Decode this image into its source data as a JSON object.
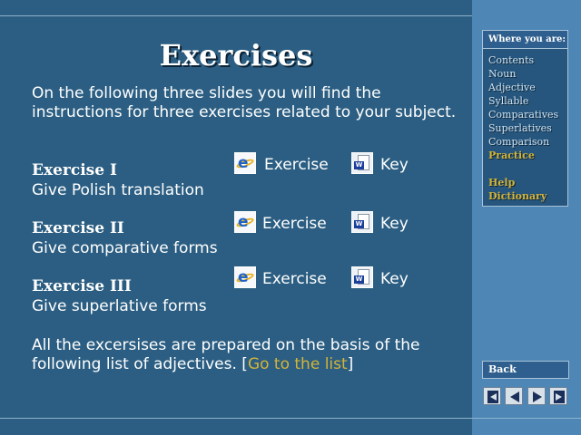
{
  "slide": {
    "title": "Exercises",
    "intro": "On the following three slides you will find the instructions for three exercises related to your subject.",
    "exercises": [
      {
        "heading": "Exercise I",
        "description": "Give Polish translation",
        "exercise_label": "Exercise",
        "key_label": "Key"
      },
      {
        "heading": "Exercise II",
        "description": "Give comparative forms",
        "exercise_label": "Exercise",
        "key_label": "Key"
      },
      {
        "heading": "Exercise III",
        "description": "Give superlative forms",
        "exercise_label": "Exercise",
        "key_label": "Key"
      }
    ],
    "outro_before": "All the excersises are prepared on the basis of the following list of adjectives. [",
    "outro_link": "Go to the list",
    "outro_after": "]"
  },
  "sidebar": {
    "panel_title": "Where you are:",
    "nav_items": [
      {
        "label": "Contents"
      },
      {
        "label": "Noun"
      },
      {
        "label": "Adjective"
      },
      {
        "label": "Syllable"
      },
      {
        "label": "Comparatives"
      },
      {
        "label": "Superlatives"
      },
      {
        "label": "Comparison"
      },
      {
        "label": "Practice"
      }
    ],
    "extra_items": [
      {
        "label": "Help"
      },
      {
        "label": "Dictionary"
      }
    ],
    "back_label": "Back",
    "nav_buttons": [
      "first-slide-icon",
      "previous-slide-icon",
      "next-slide-icon",
      "last-slide-icon"
    ]
  },
  "colors": {
    "background": "#2b5e82",
    "sidebar": "#4e86b5",
    "accent_gold": "#d4b438"
  }
}
